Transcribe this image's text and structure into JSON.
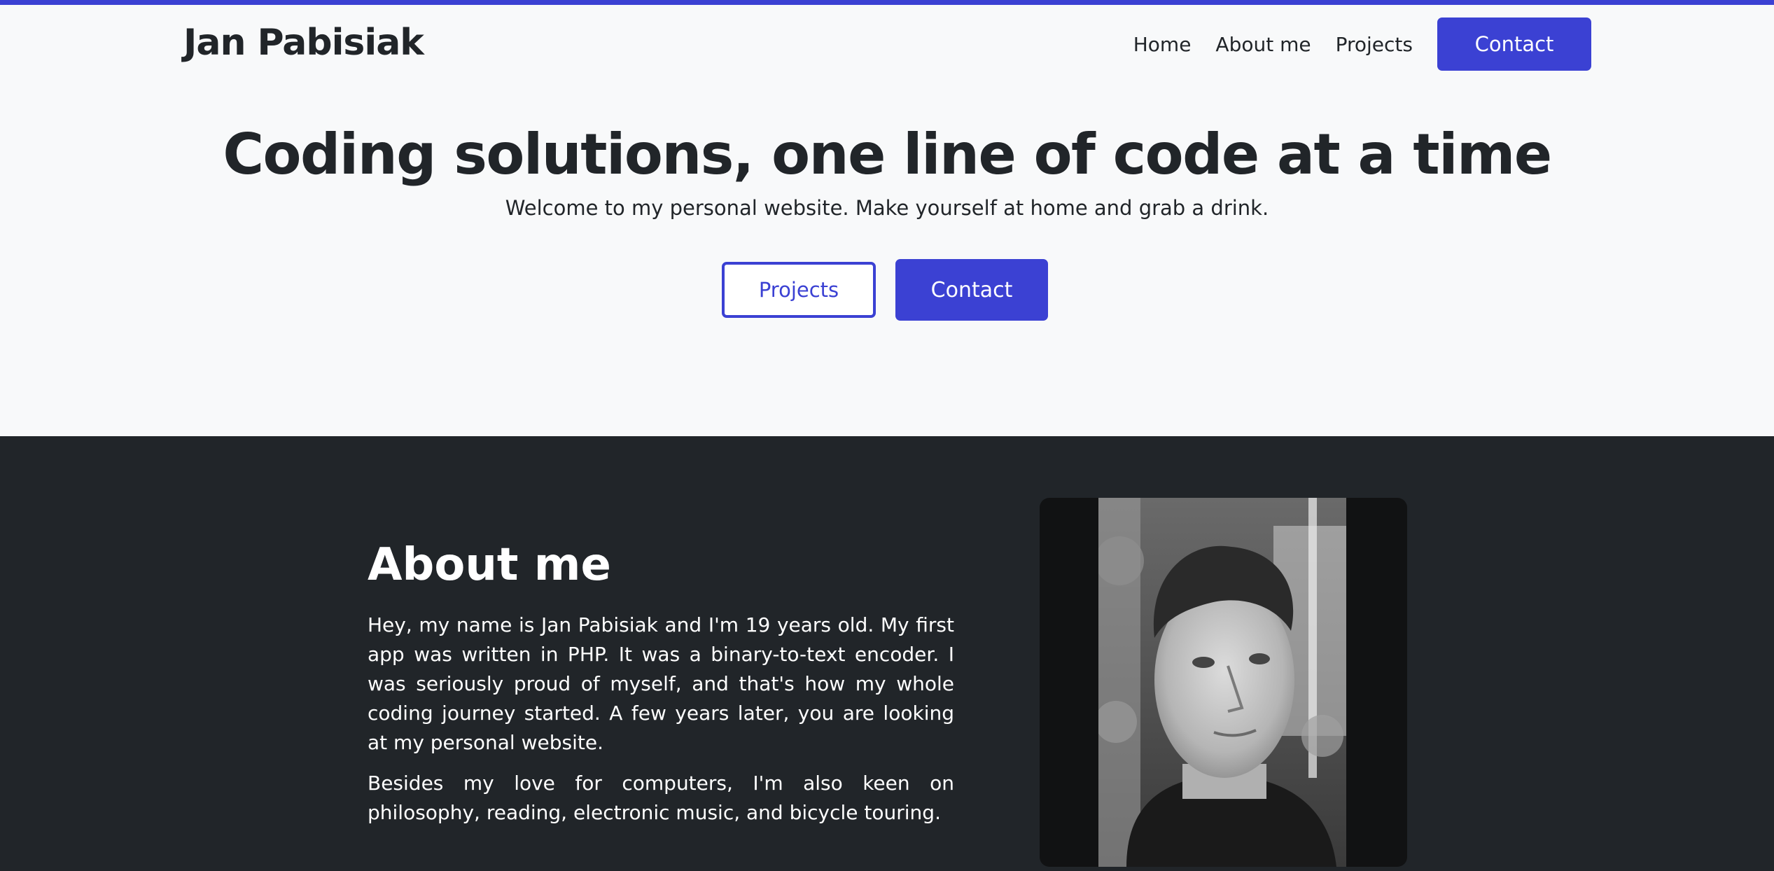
{
  "brand": {
    "name": "Jan Pabisiak"
  },
  "nav": {
    "items": [
      "Home",
      "About me",
      "Projects"
    ],
    "contact_label": "Contact"
  },
  "hero": {
    "title": "Coding solutions, one line of code at a time",
    "subtitle": "Welcome to my personal website. Make yourself at home and grab a drink.",
    "projects_button": "Projects",
    "contact_button": "Contact"
  },
  "about": {
    "title": "About me",
    "paragraphs": [
      "Hey, my name is Jan Pabisiak and I'm 19 years old. My first app was written in PHP. It was a binary-to-text encoder. I was seriously proud of myself, and that's how my whole coding journey started. A few years later, you are looking at my personal website.",
      "Besides my love for computers, I'm also keen on philosophy, reading, electronic music, and bicycle touring."
    ]
  },
  "colors": {
    "accent": "#3b41d3",
    "dark_section": "#212529",
    "page_background": "#f8f9fa"
  }
}
